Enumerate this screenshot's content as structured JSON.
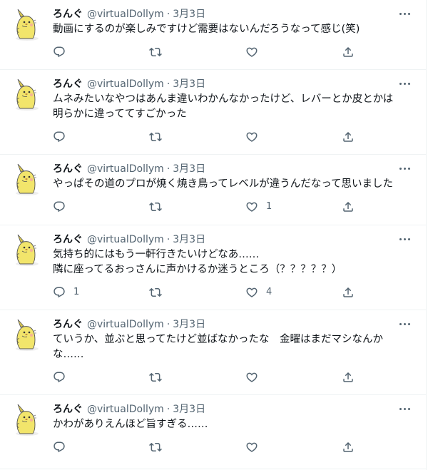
{
  "colors": {
    "text": "#0f1419",
    "secondary": "#536471",
    "border": "#eff3f4"
  },
  "icons": {
    "reply": "reply-icon",
    "retweet": "retweet-icon",
    "like": "heart-icon",
    "share": "share-icon",
    "more": "more-icon"
  },
  "tweets": [
    {
      "name": "ろんぐ",
      "handle": "@virtualDollym",
      "sep": "·",
      "date": "3月3日",
      "text": "動画にするのが楽しみですけど需要はないんだろうなって感じ(笑)",
      "replies": "",
      "retweets": "",
      "likes": ""
    },
    {
      "name": "ろんぐ",
      "handle": "@virtualDollym",
      "sep": "·",
      "date": "3月3日",
      "text": "ムネみたいなやつはあんま違いわかんなかったけど、レバーとか皮とかは明らかに違っててすごかった",
      "replies": "",
      "retweets": "",
      "likes": ""
    },
    {
      "name": "ろんぐ",
      "handle": "@virtualDollym",
      "sep": "·",
      "date": "3月3日",
      "text": "やっぱその道のプロが焼く焼き鳥ってレベルが違うんだなって思いました",
      "replies": "",
      "retweets": "",
      "likes": "1"
    },
    {
      "name": "ろんぐ",
      "handle": "@virtualDollym",
      "sep": "·",
      "date": "3月3日",
      "text": "気持ち的にはもう一軒行きたいけどなあ……\n隣に座ってるおっさんに声かけるか迷うところ（？？？？？）",
      "replies": "1",
      "retweets": "",
      "likes": "4"
    },
    {
      "name": "ろんぐ",
      "handle": "@virtualDollym",
      "sep": "·",
      "date": "3月3日",
      "text": "ていうか、並ぶと思ってたけど並ばなかったな　金曜はまだマシなんかな……",
      "replies": "",
      "retweets": "",
      "likes": ""
    },
    {
      "name": "ろんぐ",
      "handle": "@virtualDollym",
      "sep": "·",
      "date": "3月3日",
      "text": "かわがありえんほど旨すぎる……",
      "replies": "",
      "retweets": "",
      "likes": ""
    }
  ]
}
